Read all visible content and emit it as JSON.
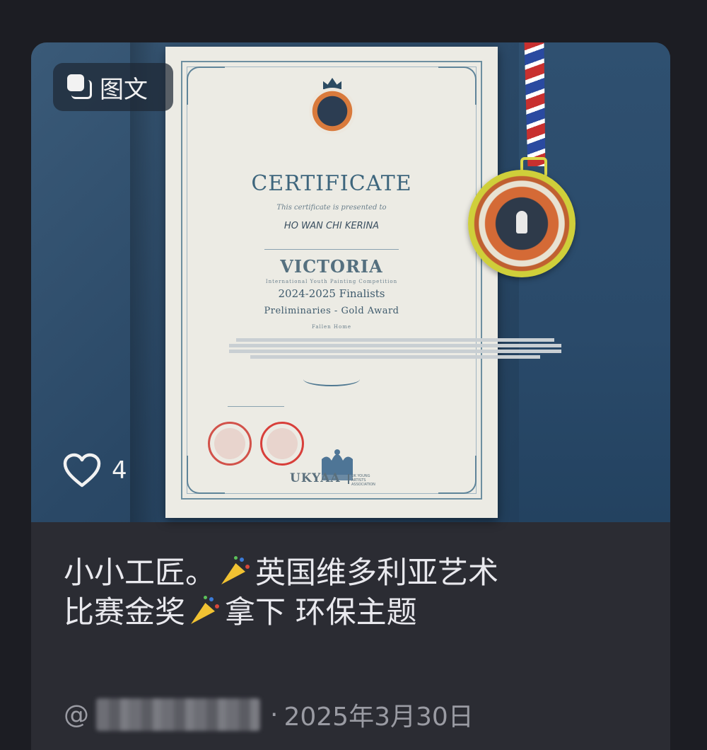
{
  "post": {
    "badge_label": "图文",
    "badge_icon": "stacked-pages-icon",
    "like_icon": "heart-outline-icon",
    "like_count": "4",
    "title_line1_part1": "小小工匠。",
    "title_line1_part2": "英国维多利亚艺术",
    "title_line2_part1": "比赛金奖",
    "title_line2_part2": "拿下 环保主题",
    "title_emoji": "party-popper-icon",
    "author_prefix": "@",
    "separator": "·",
    "date": "2025年3月30日"
  },
  "certificate": {
    "heading": "CERTIFICATE",
    "presented_to": "This certificate is presented to",
    "recipient": "HO WAN CHI KERINA",
    "org": "VICTORIA",
    "competition": "International Youth Painting Competition",
    "finalists": "2024-2025 Finalists",
    "award": "Preliminaries - Gold Award",
    "artwork": "Fallen Home",
    "footer_brand": "UKYAA",
    "footer_sub": "UK YOUNG ARTISTS ASSOCIATION"
  },
  "colors": {
    "page_bg": "#1c1d23",
    "card_bg": "#2b2c33",
    "title_text": "#e9e9ee",
    "meta_text": "#9a9ba3",
    "cert_ink": "#3e667d",
    "medal_gold": "#cfcf3a"
  }
}
